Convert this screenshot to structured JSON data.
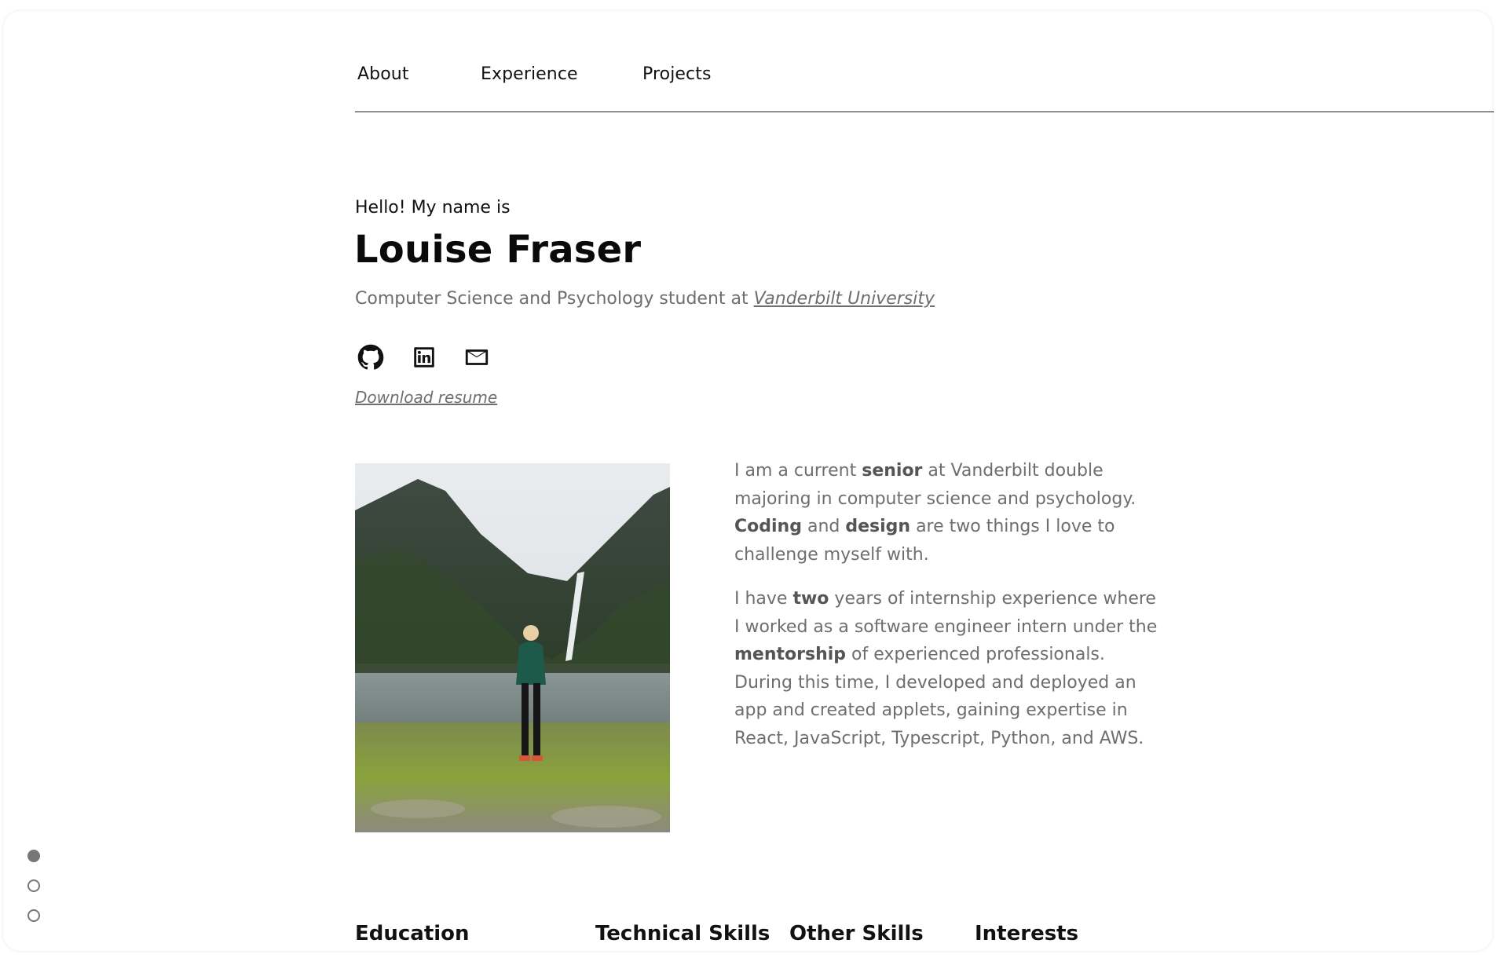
{
  "nav": {
    "items": [
      {
        "label": "About"
      },
      {
        "label": "Experience"
      },
      {
        "label": "Projects"
      }
    ]
  },
  "hero": {
    "greeting": "Hello! My name is",
    "name": "Louise Fraser",
    "subtitle_prefix": "Computer Science and Psychology student at ",
    "subtitle_link": "Vanderbilt University",
    "download_label": "Download resume",
    "icons": [
      "github-icon",
      "linkedin-icon",
      "email-icon"
    ]
  },
  "bio": {
    "p1": [
      {
        "text": "I am a current ",
        "bold": false
      },
      {
        "text": "senior",
        "bold": true
      },
      {
        "text": " at Vanderbilt double majoring in computer science and psychology. ",
        "bold": false
      },
      {
        "text": "Coding",
        "bold": true
      },
      {
        "text": " and ",
        "bold": false
      },
      {
        "text": "design",
        "bold": true
      },
      {
        "text": " are two things I love to challenge myself with.",
        "bold": false
      }
    ],
    "p2": [
      {
        "text": "I have ",
        "bold": false
      },
      {
        "text": "two",
        "bold": true
      },
      {
        "text": " years of internship experience where I worked as a software engineer intern under the ",
        "bold": false
      },
      {
        "text": "mentorship",
        "bold": true
      },
      {
        "text": " of experienced professionals. During this time, I developed and deployed an app and created applets, gaining expertise in React, JavaScript, Typescript, Python, and AWS.",
        "bold": false
      }
    ]
  },
  "sections": [
    "Education",
    "Technical Skills",
    "Other Skills",
    "Interests"
  ],
  "pagination": {
    "active_index": 0,
    "count": 3
  },
  "colors": {
    "text": "#111111",
    "muted": "#6e6e6e",
    "dot": "#777777"
  }
}
